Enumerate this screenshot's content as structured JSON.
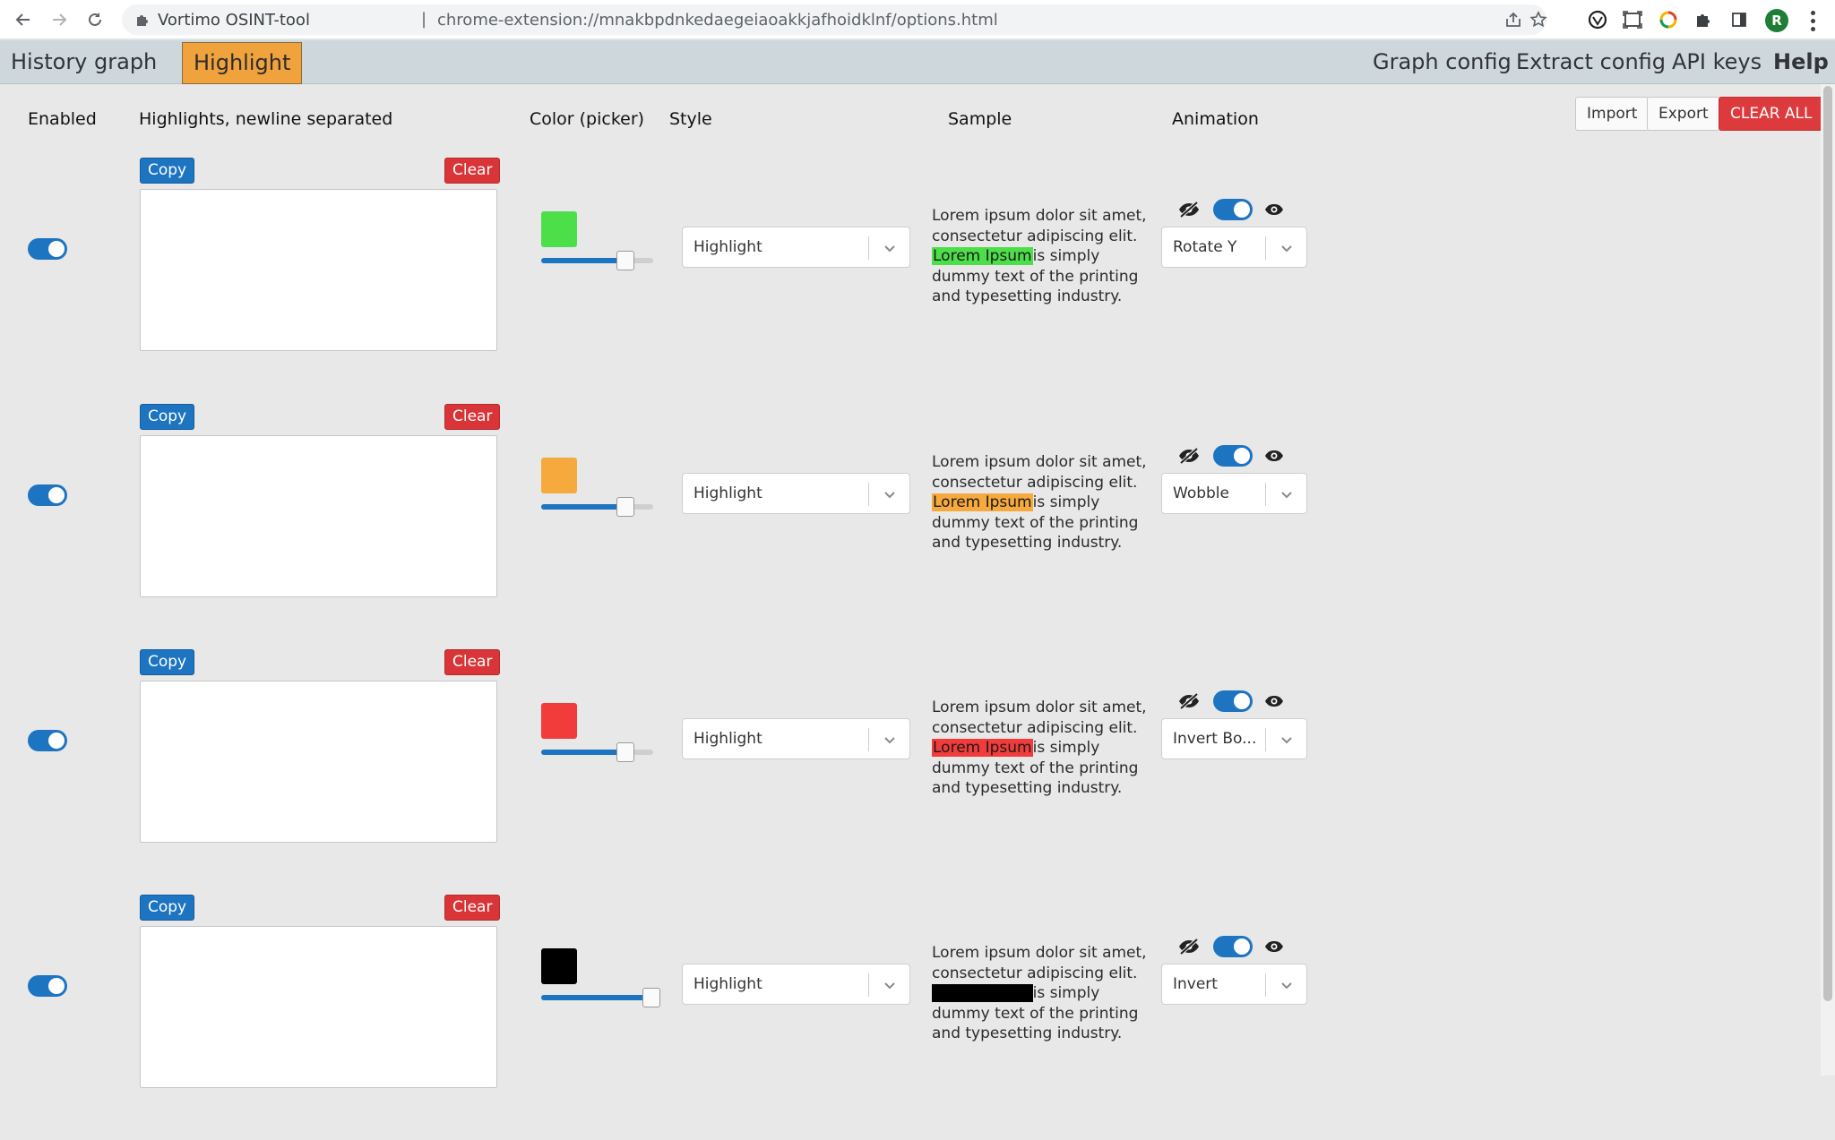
{
  "browser": {
    "tab_title": "Vortimo OSINT-tool",
    "separator": "|",
    "url": "chrome-extension://mnakbpdnkedaegeiaoakkjafhoidklnf/options.html",
    "avatar_letter": "R"
  },
  "nav": {
    "left_tabs": [
      "History graph",
      "Highlight"
    ],
    "active_tab": "Highlight",
    "right_tabs": [
      "Graph config",
      "Extract config",
      "API keys",
      "Help"
    ]
  },
  "headers": {
    "enabled": "Enabled",
    "highlights": "Highlights, newline separated",
    "color": "Color (picker)",
    "style": "Style",
    "sample": "Sample",
    "animation": "Animation"
  },
  "actions": {
    "import": "Import",
    "export": "Export",
    "clear_all": "CLEAR ALL"
  },
  "rows": [
    {
      "enabled": true,
      "copy": "Copy",
      "clear": "Clear",
      "text": "",
      "color": "#4ddf4a",
      "slider_value": 0.75,
      "style": "Highlight",
      "sample_before": "Lorem ipsum dolor sit amet, consectetur adipiscing elit.",
      "sample_highlight": "Lorem Ipsum",
      "highlight_text_color": "#1a1a1a",
      "sample_after": "is simply dummy text of the printing and typesetting industry.",
      "animation_enabled": true,
      "animation": "Rotate Y"
    },
    {
      "enabled": true,
      "copy": "Copy",
      "clear": "Clear",
      "text": "",
      "color": "#f6a93c",
      "slider_value": 0.75,
      "style": "Highlight",
      "sample_before": "Lorem ipsum dolor sit amet, consectetur adipiscing elit.",
      "sample_highlight": "Lorem Ipsum",
      "highlight_text_color": "#1a1a1a",
      "sample_after": "is simply dummy text of the printing and typesetting industry.",
      "animation_enabled": true,
      "animation": "Wobble"
    },
    {
      "enabled": true,
      "copy": "Copy",
      "clear": "Clear",
      "text": "",
      "color": "#f23c3c",
      "slider_value": 0.75,
      "style": "Highlight",
      "sample_before": "Lorem ipsum dolor sit amet, consectetur adipiscing elit.",
      "sample_highlight": "Lorem Ipsum",
      "highlight_text_color": "#1a1a1a",
      "sample_after": "is simply dummy text of the printing and typesetting industry.",
      "animation_enabled": true,
      "animation": "Invert Bo..."
    },
    {
      "enabled": true,
      "copy": "Copy",
      "clear": "Clear",
      "text": "",
      "color": "#000000",
      "slider_value": 1.0,
      "style": "Highlight",
      "sample_before": "Lorem ipsum dolor sit amet, consectetur adipiscing elit.",
      "sample_highlight": "Lorem Ipsum",
      "highlight_text_color": "#000000",
      "sample_after": "is simply dummy text of the printing and typesetting industry.",
      "animation_enabled": true,
      "animation": "Invert"
    }
  ]
}
